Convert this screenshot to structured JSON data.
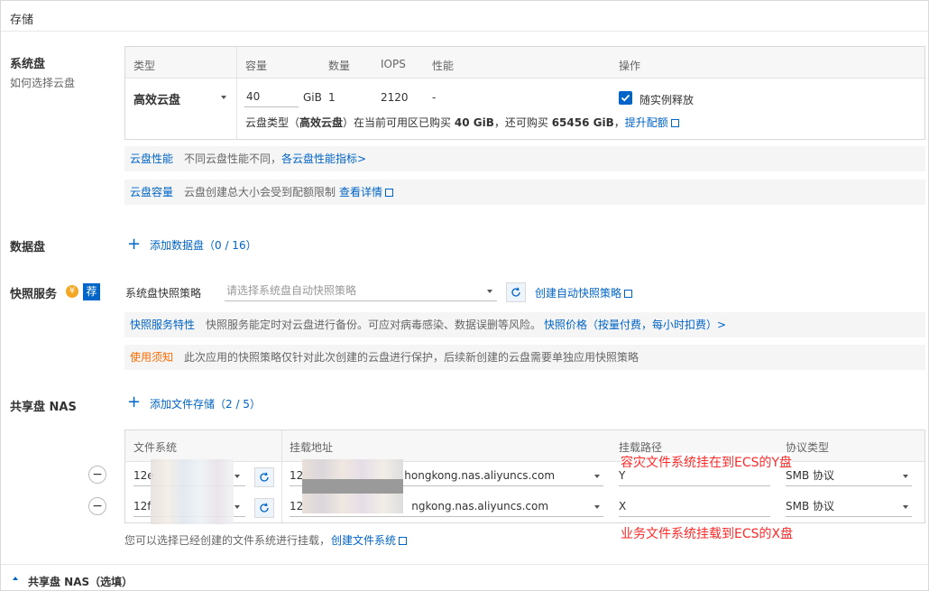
{
  "header": {
    "title": "存储"
  },
  "system_disk": {
    "title": "系统盘",
    "help_link": "如何选择云盘",
    "columns": {
      "type": "类型",
      "capacity": "容量",
      "count": "数量",
      "iops": "IOPS",
      "performance": "性能",
      "action": "操作"
    },
    "row": {
      "type": "高效云盘",
      "capacity": "40",
      "unit": "GiB",
      "count": "1",
      "iops": "2120",
      "performance": "-",
      "release_label": "随实例释放"
    },
    "quota": {
      "prefix": "云盘类型（",
      "type_bold": "高效云盘",
      "middle": "）在当前可用区已购买 ",
      "bought": "40 GiB",
      "middle2": "，还可购买 ",
      "remain": "65456 GiB",
      "sep": "，",
      "link": "提升配额"
    },
    "tips": [
      {
        "tag": "云盘性能",
        "text": "不同云盘性能不同，",
        "link": "各云盘性能指标>"
      },
      {
        "tag": "云盘容量",
        "text": "云盘创建总大小会受到配额限制",
        "link": "查看详情"
      }
    ]
  },
  "data_disk": {
    "title": "数据盘",
    "add_label": "添加数据盘（0 / 16）"
  },
  "snapshot": {
    "title": "快照服务",
    "badge": "荐",
    "policy_label": "系统盘快照策略",
    "placeholder": "请选择系统盘自动快照策略",
    "create_link": "创建自动快照策略",
    "tips": [
      {
        "tag": "快照服务特性",
        "text": "快照服务能定时对云盘进行备份。可应对病毒感染、数据误删等风险。",
        "link": "快照价格（按量付费，每小时扣费）>"
      },
      {
        "tag": "使用须知",
        "text": "此次应用的快照策略仅针对此次创建的云盘进行保护，后续新创建的云盘需要单独应用快照策略"
      }
    ]
  },
  "nas": {
    "title": "共享盘 NAS",
    "add_label": "添加文件存储（2 / 5）",
    "columns": {
      "fs": "文件系统",
      "mount_addr": "挂载地址",
      "mount_path": "挂载路径",
      "protocol": "协议类型"
    },
    "rows": [
      {
        "fs": "12e",
        "addr_prefix": "12",
        "addr_suffix": "hongkong.nas.aliyuncs.com",
        "path": "Y",
        "protocol": "SMB 协议"
      },
      {
        "fs": "12f",
        "addr_prefix": "12",
        "addr_suffix": "ngkong.nas.aliyuncs.com",
        "path": "X",
        "protocol": "SMB 协议"
      }
    ],
    "annotation_y": "容灾文件系统挂在到ECS的Y盘",
    "annotation_x": "业务文件系统挂载到ECS的X盘",
    "footer_text": "您可以选择已经创建的文件系统进行挂载，",
    "footer_link": "创建文件系统",
    "collapse_label": "共享盘 NAS（选填）"
  },
  "colors": {
    "accent": "#0064c8",
    "annotation": "#ff2a2a",
    "warn": "#ff6a00"
  }
}
